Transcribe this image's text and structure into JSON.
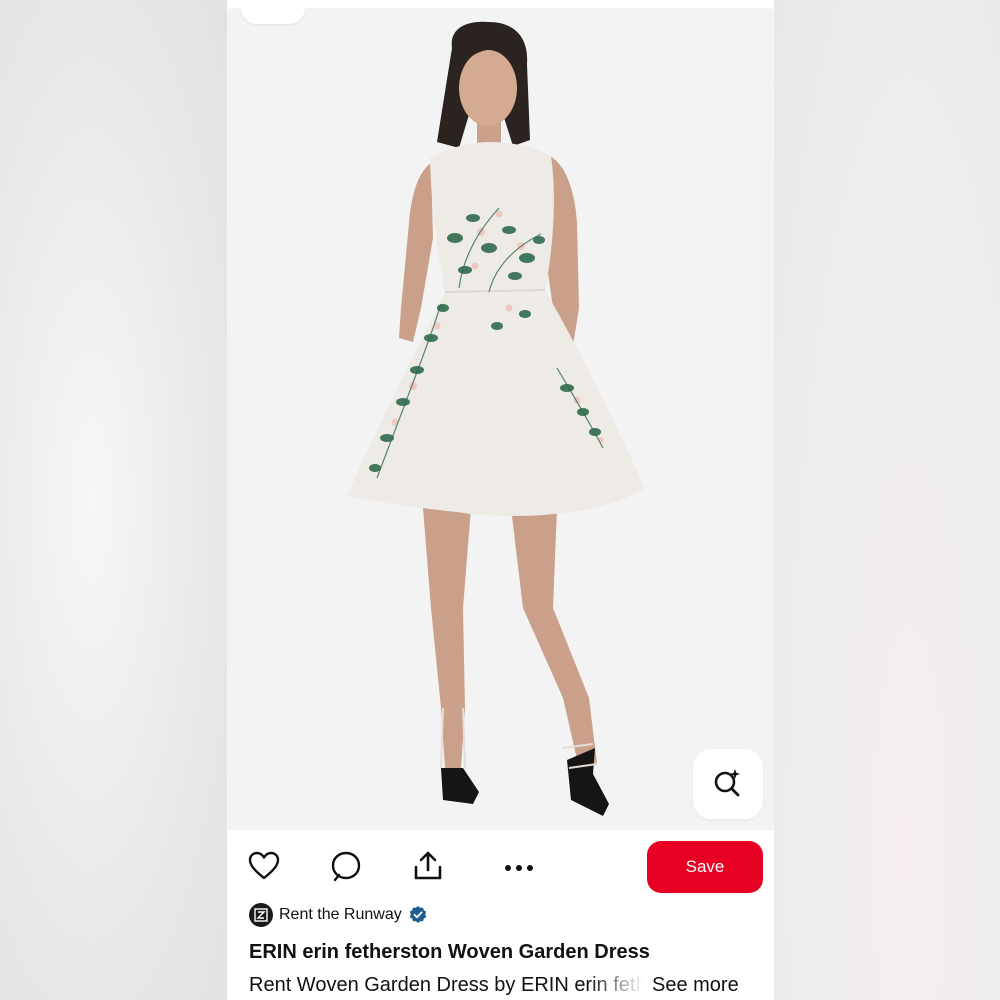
{
  "actions": {
    "like_icon": "heart-icon",
    "comment_icon": "comment-icon",
    "share_icon": "share-icon",
    "more_icon": "more-options-icon",
    "save_label": "Save"
  },
  "visual_search": {
    "icon": "visual-search-icon"
  },
  "creator": {
    "name": "Rent the Runway",
    "verified": true
  },
  "pin": {
    "title": "ERIN erin fetherston Woven Garden Dress",
    "description": "Rent Woven Garden Dress by ERIN erin fetherston",
    "see_more_label": "See more"
  },
  "colors": {
    "save_button": "#e60023",
    "verified_badge": "#1d5e8c",
    "dress": "#eeeae6",
    "floral_leaf": "#2f6b4f",
    "floral_blossom": "#f0c8bf"
  }
}
